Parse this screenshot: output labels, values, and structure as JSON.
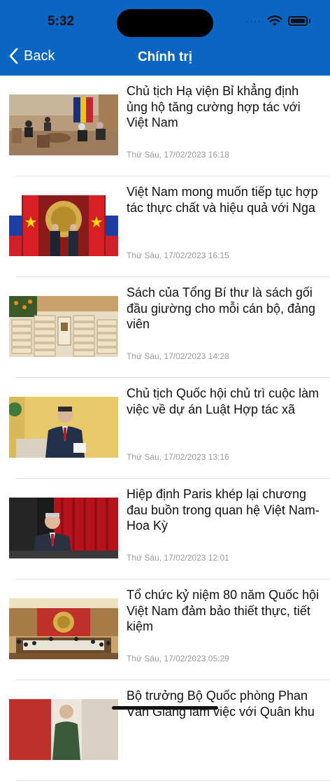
{
  "status_bar": {
    "time": "5:32",
    "signal_dots": "····"
  },
  "nav": {
    "back_label": "Back",
    "title": "Chính trị"
  },
  "articles": [
    {
      "title": "Chủ tịch Hạ viện Bỉ khẳng định ủng hộ tăng cường hợp tác với Việt Nam",
      "time": "Thứ Sáu, 17/02/2023 16:18"
    },
    {
      "title": "Việt Nam mong muốn tiếp tục hợp tác thực chất và hiệu quả với Nga",
      "time": "Thứ Sáu, 17/02/2023 16:15"
    },
    {
      "title": "Sách của Tổng Bí thư là sách gối đầu giường cho mỗi cán bộ, đảng viên",
      "time": "Thứ Sáu, 17/02/2023 14:28"
    },
    {
      "title": "Chủ tịch Quốc hội chủ trì cuộc làm việc về dự án Luật Hợp tác xã",
      "time": "Thứ Sáu, 17/02/2023 13:16"
    },
    {
      "title": "Hiệp định Paris khép lại chương đau buồn trong quan hệ Việt Nam-Hoa Kỳ",
      "time": "Thứ Sáu, 17/02/2023 12:01"
    },
    {
      "title": "Tổ chức kỷ niệm 80 năm Quốc hội Việt Nam đảm bảo thiết thực, tiết kiệm",
      "time": "Thứ Sáu, 17/02/2023 05:29"
    },
    {
      "title": "Bộ trưởng Bộ Quốc phòng Phan Văn Giang làm việc với Quân khu",
      "time": ""
    }
  ]
}
